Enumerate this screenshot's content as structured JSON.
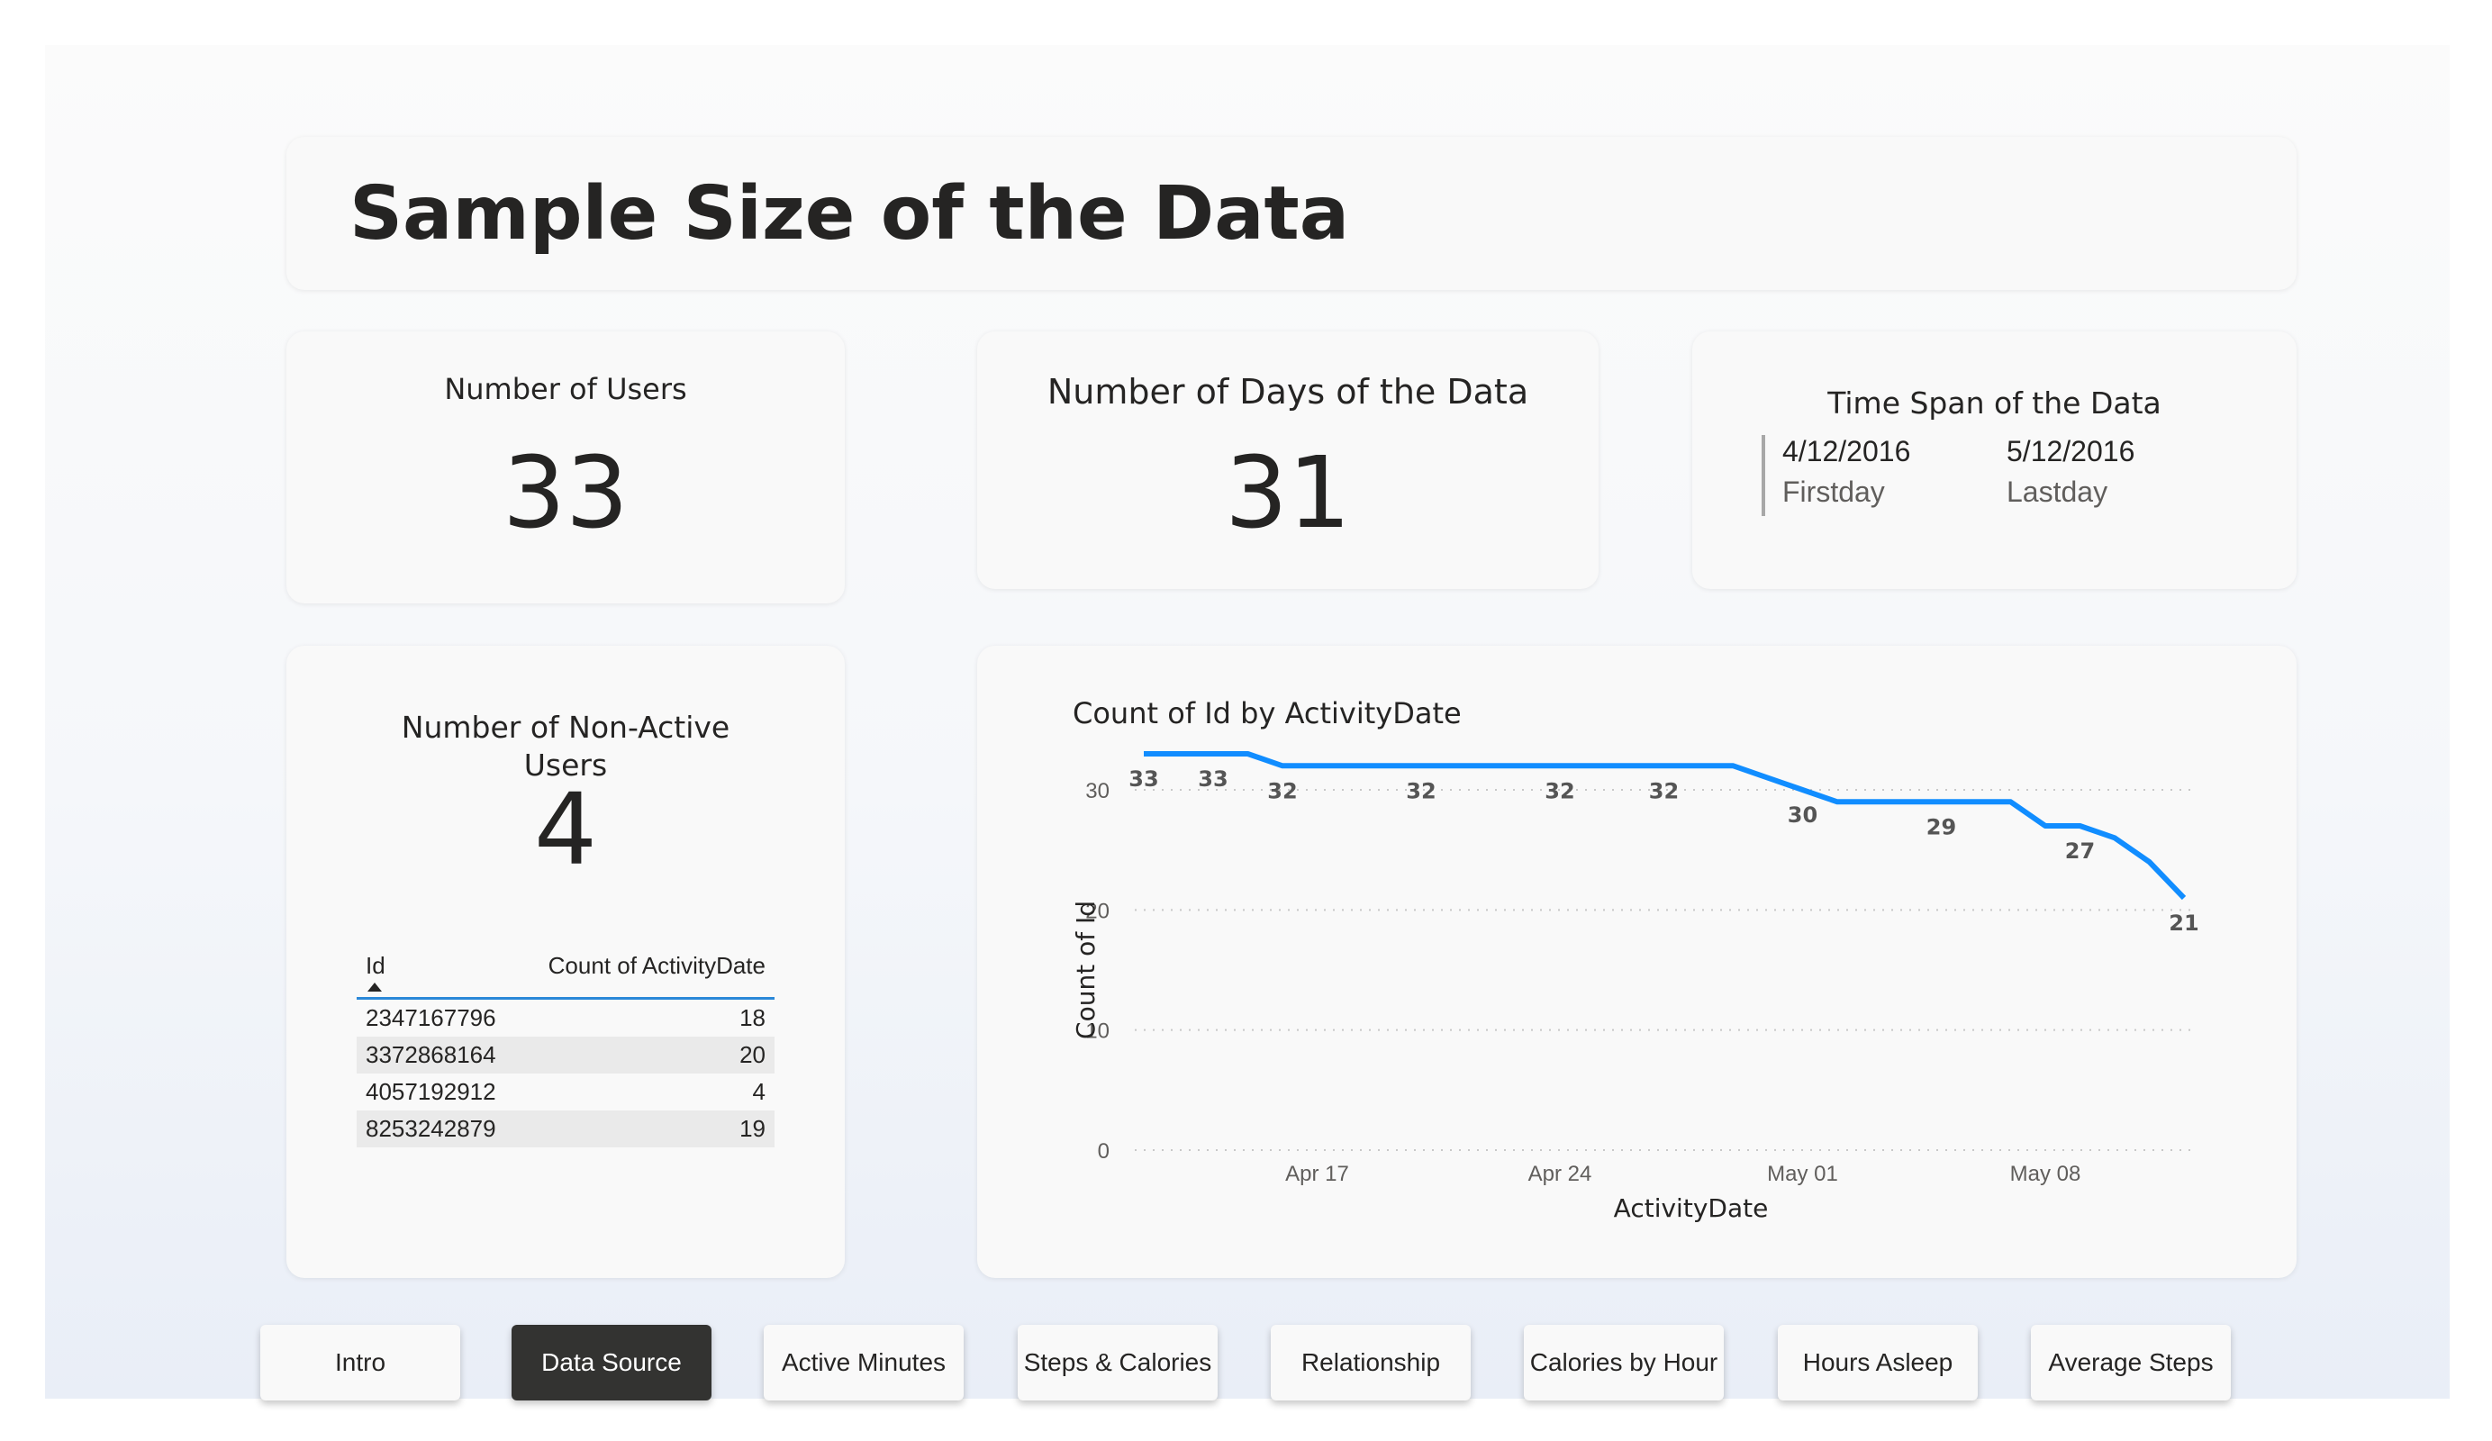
{
  "header": {
    "title": "Sample Size of the Data"
  },
  "kpis": {
    "users": {
      "label": "Number of Users",
      "value": "33"
    },
    "days": {
      "label": "Number of Days of the Data",
      "value": "31"
    },
    "nonactive": {
      "label_line1": "Number of Non-Active",
      "label_line2": "Users",
      "value": "4"
    }
  },
  "time_span": {
    "title": "Time Span of the Data",
    "first_date": "4/12/2016",
    "first_label": "Firstday",
    "last_date": "5/12/2016",
    "last_label": "Lastday"
  },
  "nonactive_table": {
    "columns": [
      "Id",
      "Count of ActivityDate"
    ],
    "rows": [
      [
        "2347167796",
        "18"
      ],
      [
        "3372868164",
        "20"
      ],
      [
        "4057192912",
        "4"
      ],
      [
        "8253242879",
        "19"
      ]
    ]
  },
  "chart_data": {
    "type": "line",
    "title": "Count of Id by ActivityDate",
    "xlabel": "ActivityDate",
    "ylabel": "Count of Id",
    "x_ticks": [
      "Apr 17",
      "Apr 24",
      "May 01",
      "May 08"
    ],
    "y_ticks": [
      "0",
      "10",
      "20",
      "30"
    ],
    "ylim": [
      0,
      33
    ],
    "grid": true,
    "color": "#118dff",
    "x": [
      "2016-04-12",
      "2016-04-13",
      "2016-04-14",
      "2016-04-15",
      "2016-04-16",
      "2016-04-17",
      "2016-04-18",
      "2016-04-19",
      "2016-04-20",
      "2016-04-21",
      "2016-04-22",
      "2016-04-23",
      "2016-04-24",
      "2016-04-25",
      "2016-04-26",
      "2016-04-27",
      "2016-04-28",
      "2016-04-29",
      "2016-04-30",
      "2016-05-01",
      "2016-05-02",
      "2016-05-03",
      "2016-05-04",
      "2016-05-05",
      "2016-05-06",
      "2016-05-07",
      "2016-05-08",
      "2016-05-09",
      "2016-05-10",
      "2016-05-11",
      "2016-05-12"
    ],
    "values": [
      33,
      33,
      33,
      33,
      32,
      32,
      32,
      32,
      32,
      32,
      32,
      32,
      32,
      32,
      32,
      32,
      32,
      32,
      31,
      30,
      29,
      29,
      29,
      29,
      29,
      29,
      27,
      27,
      26,
      24,
      21
    ],
    "data_labels": [
      {
        "index": 0,
        "label": "33"
      },
      {
        "index": 2,
        "label": "33"
      },
      {
        "index": 4,
        "label": "32"
      },
      {
        "index": 8,
        "label": "32"
      },
      {
        "index": 12,
        "label": "32"
      },
      {
        "index": 15,
        "label": "32"
      },
      {
        "index": 19,
        "label": "30"
      },
      {
        "index": 23,
        "label": "29"
      },
      {
        "index": 27,
        "label": "27"
      },
      {
        "index": 30,
        "label": "21"
      }
    ]
  },
  "nav": {
    "buttons": [
      "Intro",
      "Data Source",
      "Active Minutes",
      "Steps & Calories",
      "Relationship",
      "Calories by Hour",
      "Hours Asleep",
      "Average Steps"
    ],
    "active": "Data Source"
  }
}
